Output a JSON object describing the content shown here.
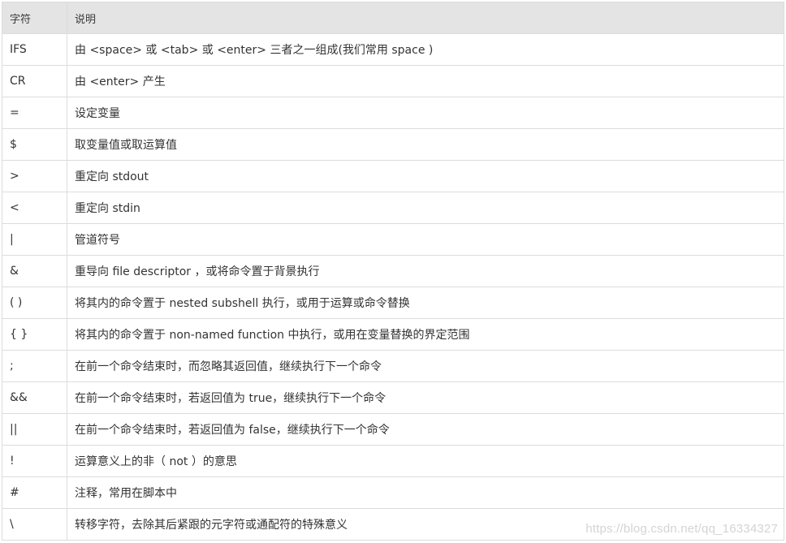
{
  "table": {
    "headers": [
      "字符",
      "说明"
    ],
    "rows": [
      {
        "char": "IFS",
        "desc": "由 <space> 或 <tab> 或 <enter> 三者之一组成(我们常用 space )"
      },
      {
        "char": "CR",
        "desc": "由 <enter> 产生"
      },
      {
        "char": "=",
        "desc": "设定变量"
      },
      {
        "char": "$",
        "desc": "取变量值或取运算值"
      },
      {
        "char": ">",
        "desc": "重定向 stdout"
      },
      {
        "char": "<",
        "desc": "重定向 stdin"
      },
      {
        "char": "|",
        "desc": "管道符号"
      },
      {
        "char": "&",
        "desc": "重导向 file descriptor ，或将命令置于背景执行"
      },
      {
        "char": "( )",
        "desc": "将其内的命令置于 nested subshell 执行，或用于运算或命令替换"
      },
      {
        "char": "{ }",
        "desc": "将其内的命令置于 non-named function 中执行，或用在变量替换的界定范围"
      },
      {
        "char": ";",
        "desc": "在前一个命令结束时，而忽略其返回值，继续执行下一个命令"
      },
      {
        "char": "&&",
        "desc": "在前一个命令结束时，若返回值为 true，继续执行下一个命令"
      },
      {
        "char": "||",
        "desc": "在前一个命令结束时，若返回值为 false，继续执行下一个命令"
      },
      {
        "char": "!",
        "desc": "运算意义上的非（ not ）的意思"
      },
      {
        "char": "#",
        "desc": "注释，常用在脚本中"
      },
      {
        "char": "\\",
        "desc": "转移字符，去除其后紧跟的元字符或通配符的特殊意义"
      }
    ]
  },
  "watermark": "https://blog.csdn.net/qq_16334327"
}
